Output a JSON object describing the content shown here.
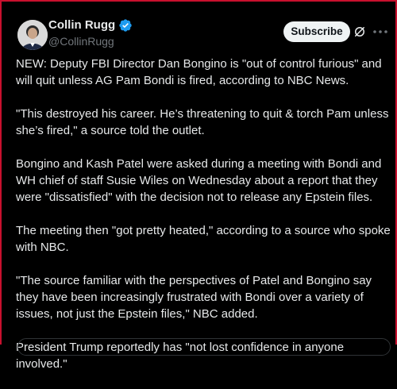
{
  "author": {
    "name": "Collin Rugg",
    "handle": "@CollinRugg",
    "verified": true,
    "badge_color": "#1d9bf0"
  },
  "actions": {
    "subscribe_label": "Subscribe",
    "grok_icon": "grok-icon",
    "more_icon": "more-options-icon"
  },
  "post": {
    "paragraphs": [
      "NEW: Deputy FBI Director Dan Bongino is \"out of control furious\" and will quit unless AG Pam Bondi is fired, according to NBC News.",
      "\"This destroyed his career. He’s threatening to quit & torch Pam unless she’s fired,\" a source told the outlet.",
      "Bongino and Kash Patel were asked during a meeting with Bondi and WH chief of staff Susie Wiles on Wednesday about a report that they were \"dissatisfied\" with the decision not to release any Epstein files.",
      "The meeting then \"got pretty heated,\" according to a source who spoke with NBC.",
      "\"The source familiar with the perspectives of Patel and Bongino say they have been increasingly frustrated with Bondi over a variety of issues, not just the Epstein files,\" NBC added.",
      "President Trump reportedly has \"not lost confidence in anyone involved.\""
    ]
  },
  "colors": {
    "background": "#000000",
    "text": "#e7e9ea",
    "secondary_text": "#71767b",
    "frame_border": "#c8102e"
  }
}
